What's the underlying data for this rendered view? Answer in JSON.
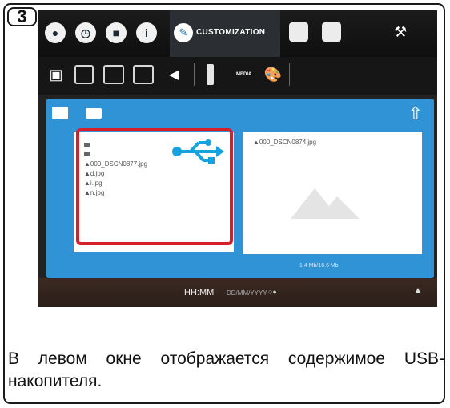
{
  "step_number": "3",
  "topbar": {
    "icons": [
      "droplet-icon",
      "clock-icon",
      "chat-icon",
      "info-icon"
    ],
    "active_tab_label": "CUSTOMIZATION",
    "extra_icons": [
      "screen-icon",
      "person-icon"
    ],
    "settings_icon": "wrench-icon"
  },
  "toolbar": {
    "icons": [
      "book-icon",
      "book-open-icon",
      "picture-frame-icon",
      "text-frame-icon",
      "speaker-icon",
      "usb-icon",
      "media-label",
      "palette-icon"
    ],
    "media_label": "MEDIA"
  },
  "panel": {
    "tabs": [
      "image-tab-icon",
      "video-tab-icon"
    ],
    "export_icon": "export-icon",
    "left_files": [
      "",
      "..",
      "000_DSCN0877.jpg",
      "d.jpg",
      "i.jpg",
      "n.jpg"
    ],
    "right_file": "000_DSCN0874.jpg",
    "storage_info": "1.4 Mb/16.6 Mb"
  },
  "status": {
    "time": "HH:MM",
    "date": "DD/MM/YYYY"
  },
  "colors": {
    "panel_blue": "#2f93d6",
    "highlight_red": "#d62028",
    "usb_cyan": "#16a2df"
  },
  "caption": "В левом окне отображается содержимое USB-накопителя."
}
